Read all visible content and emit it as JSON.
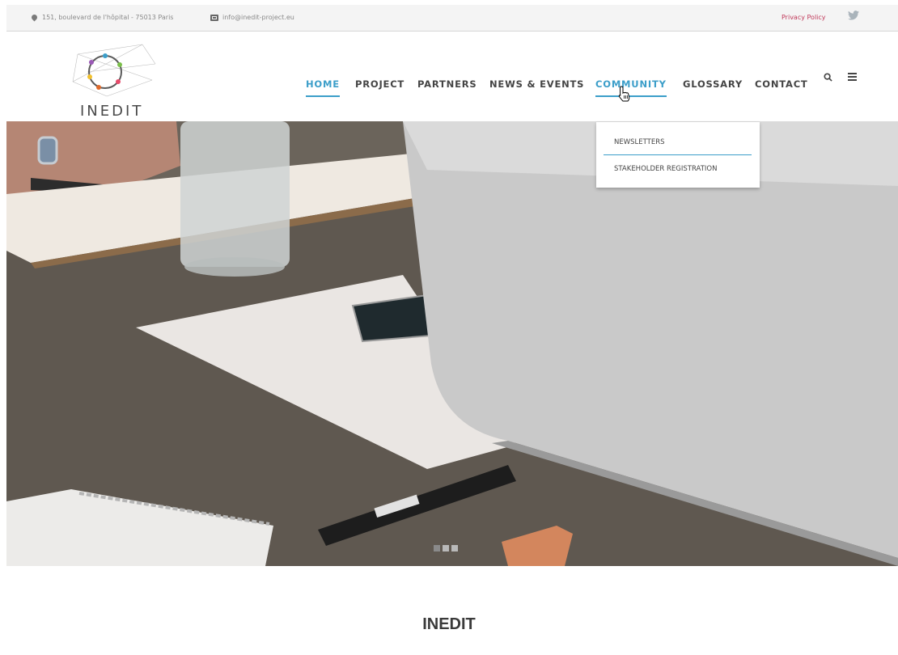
{
  "topbar": {
    "address": "151, boulevard de l'hôpital - 75013 Paris",
    "email": "info@inedit-project.eu",
    "privacy_policy": "Privacy Policy"
  },
  "logo": {
    "text": "INEDIT"
  },
  "nav": {
    "items": [
      {
        "label": "HOME",
        "state": "active"
      },
      {
        "label": "PROJECT"
      },
      {
        "label": "PARTNERS"
      },
      {
        "label": "NEWS & EVENTS"
      },
      {
        "label": "COMMUNITY",
        "state": "hover"
      },
      {
        "label": "GLOSSARY"
      },
      {
        "label": "CONTACT"
      }
    ]
  },
  "dropdown": {
    "items": [
      {
        "label": "NEWSLETTERS"
      },
      {
        "label": "STAKEHOLDER REGISTRATION"
      }
    ]
  },
  "hero": {
    "slides": 3,
    "active_slide": 1
  },
  "section": {
    "title": "INEDIT"
  },
  "colors": {
    "accent": "#3c9ec9",
    "privacy_link": "#c0395a"
  },
  "icons": [
    "map-pin-icon",
    "mail-icon",
    "twitter-icon",
    "search-icon",
    "menu-icon",
    "pointer-cursor-icon"
  ]
}
